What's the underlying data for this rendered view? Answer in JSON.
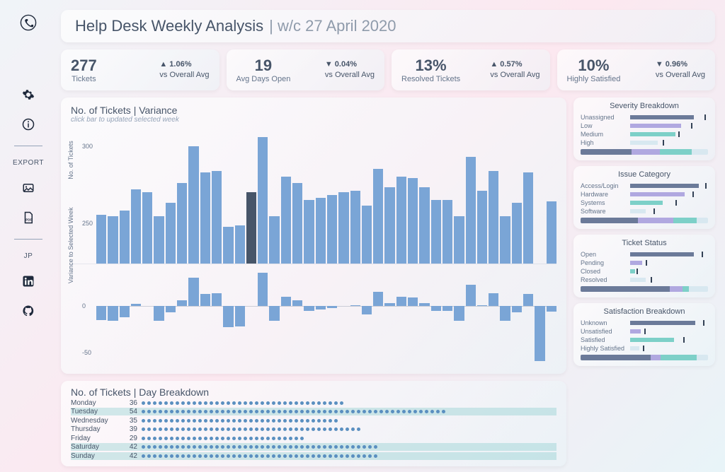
{
  "header": {
    "title": "Help Desk Weekly Analysis",
    "sep": " | ",
    "subtitle": "w/c 27 April 2020"
  },
  "sidebar": {
    "export_label": "EXPORT",
    "user_label": "JP"
  },
  "kpis": [
    {
      "value": "277",
      "label": "Tickets",
      "delta": "1.06%",
      "dir": "up",
      "sub": "vs Overall Avg"
    },
    {
      "value": "19",
      "label": "Avg Days Open",
      "delta": "0.04%",
      "dir": "dn",
      "sub": "vs Overall Avg"
    },
    {
      "value": "13%",
      "label": "Resolved Tickets",
      "delta": "0.57%",
      "dir": "up",
      "sub": "vs Overall Avg"
    },
    {
      "value": "10%",
      "label": "Highly Satisfied",
      "delta": "0.96%",
      "dir": "dn",
      "sub": "vs Overall Avg"
    }
  ],
  "variance_chart": {
    "title": "No. of Tickets | Variance",
    "hint": "click bar to updated selected week",
    "y1_label": "No. of Tickets",
    "y2_label": "Variance to Selected Week",
    "y1_ticks": [
      "300",
      "250"
    ],
    "y2_ticks": [
      "0",
      "-50"
    ]
  },
  "day_breakdown": {
    "title": "No. of Tickets | Day Breakdown",
    "rows": [
      {
        "day": "Monday",
        "val": 36,
        "hl": false
      },
      {
        "day": "Tuesday",
        "val": 54,
        "hl": true
      },
      {
        "day": "Wednesday",
        "val": 35,
        "hl": false
      },
      {
        "day": "Thursday",
        "val": 39,
        "hl": false
      },
      {
        "day": "Friday",
        "val": 29,
        "hl": false
      },
      {
        "day": "Saturday",
        "val": 42,
        "hl": true
      },
      {
        "day": "Sunday",
        "val": 42,
        "hl": true
      }
    ]
  },
  "panels": [
    {
      "title": "Severity Breakdown",
      "rows": [
        {
          "label": "Unassigned",
          "w": 82,
          "mark": 95,
          "color": "#6b7a99"
        },
        {
          "label": "Low",
          "w": 65,
          "mark": 78,
          "color": "#b0a8e0"
        },
        {
          "label": "Medium",
          "w": 58,
          "mark": 62,
          "color": "#7dd0c8"
        },
        {
          "label": "High",
          "w": 35,
          "mark": 42,
          "color": "#d8e8f0"
        }
      ],
      "stack": [
        40,
        22,
        25,
        13
      ]
    },
    {
      "title": "Issue Category",
      "rows": [
        {
          "label": "Access/Login",
          "w": 88,
          "mark": 96,
          "color": "#6b7a99"
        },
        {
          "label": "Hardware",
          "w": 70,
          "mark": 80,
          "color": "#b0a8e0"
        },
        {
          "label": "Systems",
          "w": 42,
          "mark": 58,
          "color": "#7dd0c8"
        },
        {
          "label": "Software",
          "w": 20,
          "mark": 30,
          "color": "#d8e8f0"
        }
      ],
      "stack": [
        45,
        28,
        18,
        9
      ]
    },
    {
      "title": "Ticket Status",
      "rows": [
        {
          "label": "Open",
          "w": 82,
          "mark": 92,
          "color": "#6b7a99"
        },
        {
          "label": "Pending",
          "w": 15,
          "mark": 20,
          "color": "#b0a8e0"
        },
        {
          "label": "Closed",
          "w": 6,
          "mark": 8,
          "color": "#7dd0c8"
        },
        {
          "label": "Resolved",
          "w": 20,
          "mark": 26,
          "color": "#d8e8f0"
        }
      ],
      "stack": [
        70,
        10,
        5,
        15
      ]
    },
    {
      "title": "Satisfaction Breakdown",
      "rows": [
        {
          "label": "Unknown",
          "w": 84,
          "mark": 94,
          "color": "#6b7a99"
        },
        {
          "label": "Unsatisfied",
          "w": 14,
          "mark": 18,
          "color": "#b0a8e0"
        },
        {
          "label": "Satisfied",
          "w": 56,
          "mark": 68,
          "color": "#7dd0c8"
        },
        {
          "label": "Highly Satisfied",
          "w": 12,
          "mark": 16,
          "color": "#d8e8f0"
        }
      ],
      "stack": [
        55,
        8,
        28,
        9
      ]
    }
  ],
  "chart_data": {
    "type": "bar",
    "title": "No. of Tickets | Variance (weekly)",
    "ylabel_top": "No. of Tickets",
    "ylabel_bottom": "Variance to Selected Week",
    "ylim_top": [
      230,
      320
    ],
    "ylim_bottom": [
      -65,
      40
    ],
    "selected_index": 13,
    "weeks_count": 40,
    "tickets": [
      262,
      261,
      265,
      279,
      277,
      261,
      270,
      283,
      307,
      290,
      291,
      254,
      255,
      277,
      313,
      261,
      287,
      283,
      272,
      273,
      275,
      277,
      278,
      268,
      292,
      280,
      287,
      286,
      280,
      272,
      272,
      261,
      300,
      278,
      291,
      261,
      270,
      290,
      218,
      271
    ],
    "variance": [
      -15,
      -16,
      -12,
      2,
      0,
      -16,
      -7,
      6,
      30,
      13,
      14,
      -23,
      -22,
      0,
      36,
      -16,
      10,
      6,
      -5,
      -4,
      -2,
      0,
      1,
      -9,
      15,
      3,
      10,
      9,
      3,
      -5,
      -5,
      -16,
      23,
      1,
      14,
      -16,
      -7,
      13,
      -59,
      -6
    ],
    "day_breakdown": {
      "Monday": 36,
      "Tuesday": 54,
      "Wednesday": 35,
      "Thursday": 39,
      "Friday": 29,
      "Saturday": 42,
      "Sunday": 42
    }
  }
}
